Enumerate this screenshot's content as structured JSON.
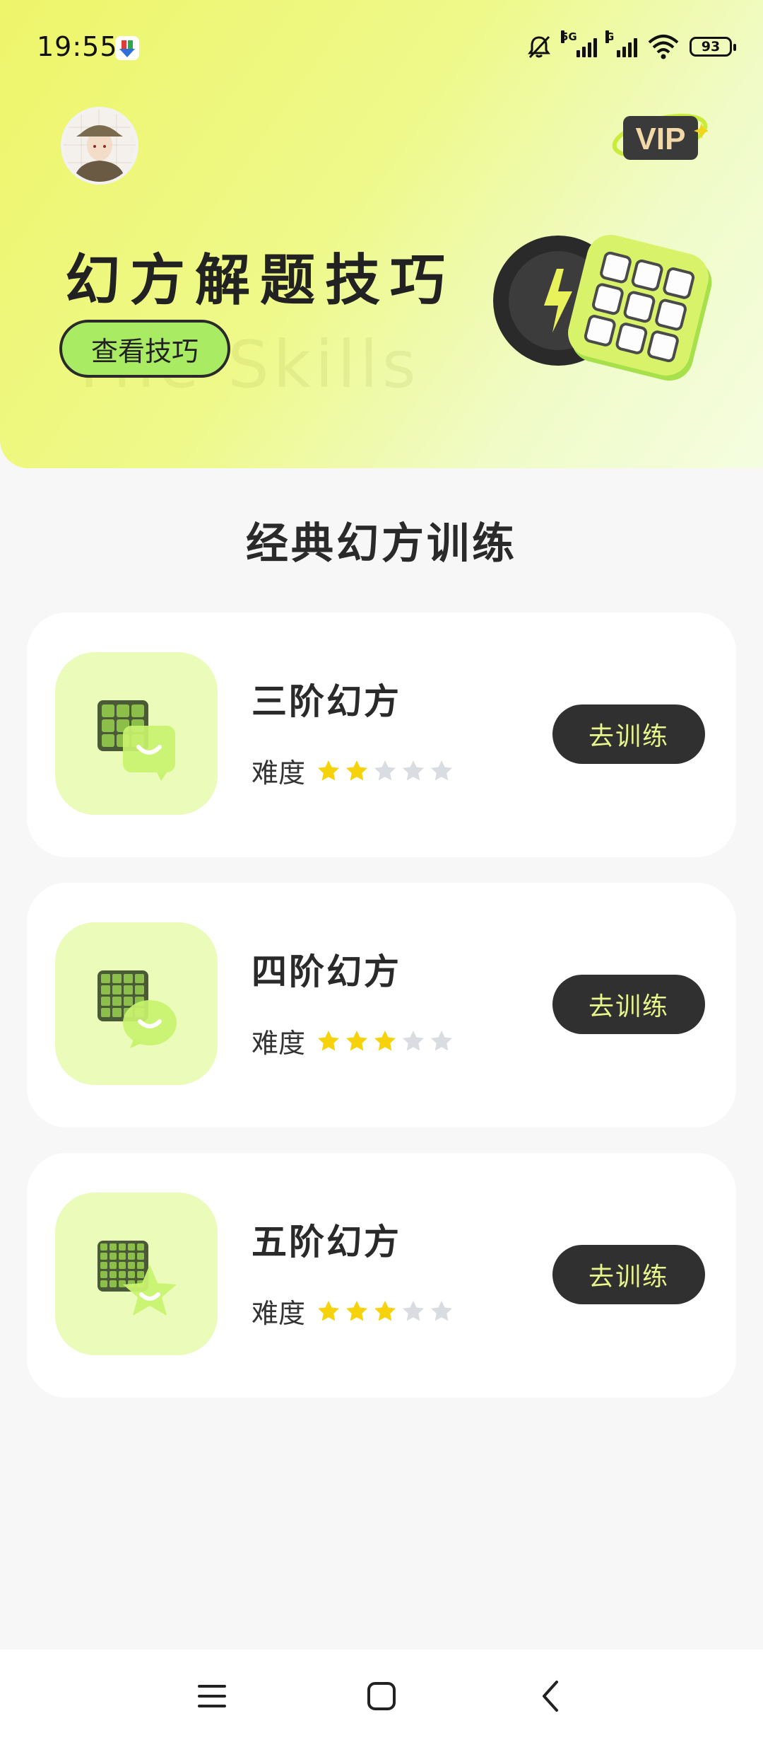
{
  "status_bar": {
    "time": "19:55",
    "network_5g": "5G",
    "network_g": "G",
    "battery": "93"
  },
  "header": {
    "vip_label": "VIP",
    "title": "幻方解题技巧",
    "watermark": "The Skills",
    "tips_button": "查看技巧"
  },
  "section_title": "经典幻方训练",
  "difficulty_label": "难度",
  "train_button": "去训练",
  "levels": [
    {
      "name": "三阶幻方",
      "difficulty": 2,
      "max": 5
    },
    {
      "name": "四阶幻方",
      "difficulty": 3,
      "max": 5
    },
    {
      "name": "五阶幻方",
      "difficulty": 3,
      "max": 5
    }
  ],
  "colors": {
    "accent": "#a9ec64",
    "star_on": "#f6d20a",
    "star_off": "#d9dde2",
    "button_bg": "#303030",
    "button_text": "#e8f58a"
  }
}
